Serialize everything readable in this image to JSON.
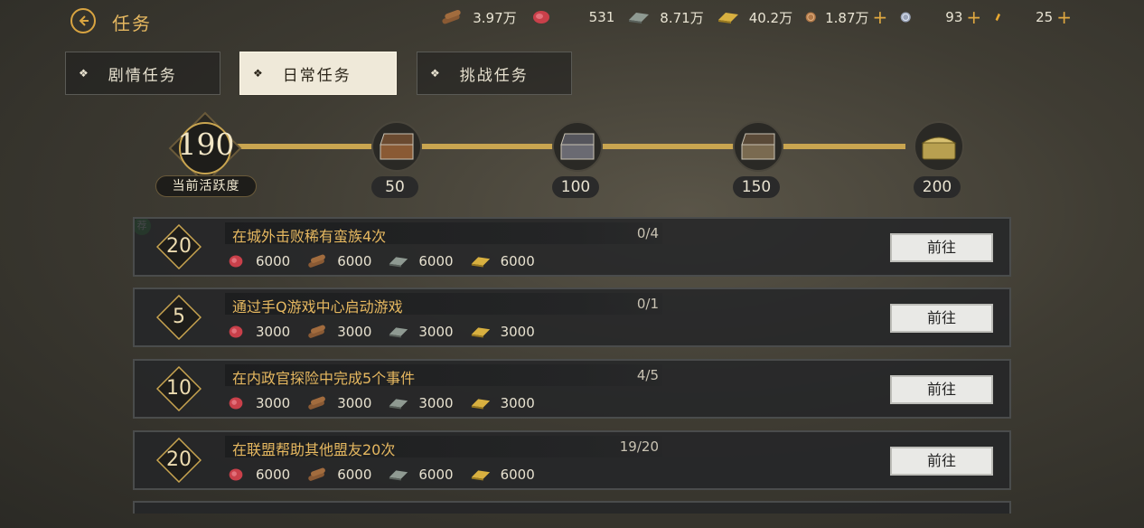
{
  "header": {
    "title": "任务",
    "resources": [
      {
        "icon": "wood-icon",
        "value": "3.97万",
        "plus": false
      },
      {
        "icon": "meat-icon",
        "value": "531",
        "plus": false
      },
      {
        "icon": "iron-icon",
        "value": "8.71万",
        "plus": false
      },
      {
        "icon": "gold-icon",
        "value": "40.2万",
        "plus": false
      },
      {
        "icon": "copper-coin-icon",
        "value": "1.87万",
        "plus": true
      },
      {
        "icon": "silver-coin-icon",
        "value": "93",
        "plus": true
      },
      {
        "icon": "jade-icon",
        "value": "25",
        "plus": true
      }
    ],
    "plus_symbol": "+"
  },
  "tabs": [
    {
      "label": "剧情任务",
      "active": false
    },
    {
      "label": "日常任务",
      "active": true
    },
    {
      "label": "挑战任务",
      "active": false
    }
  ],
  "tab_marker": "❖",
  "activity": {
    "current": "190",
    "current_label": "当前活跃度",
    "milestones": [
      {
        "value": "50",
        "claimed": true
      },
      {
        "value": "100",
        "claimed": true
      },
      {
        "value": "150",
        "claimed": true
      },
      {
        "value": "200",
        "claimed": false
      }
    ]
  },
  "recommend_badge": "荐",
  "tasks": [
    {
      "points": "20",
      "name": "在城外击败稀有蛮族4次",
      "progress": "0/4",
      "progress_fraction": 0,
      "rewards": [
        "6000",
        "6000",
        "6000",
        "6000"
      ],
      "button": "前往"
    },
    {
      "points": "5",
      "name": "通过手Q游戏中心启动游戏",
      "progress": "0/1",
      "progress_fraction": 0,
      "rewards": [
        "3000",
        "3000",
        "3000",
        "3000"
      ],
      "button": "前往"
    },
    {
      "points": "10",
      "name": "在内政官探险中完成5个事件",
      "progress": "4/5",
      "progress_fraction": 0.8,
      "rewards": [
        "3000",
        "3000",
        "3000",
        "3000"
      ],
      "button": "前往"
    },
    {
      "points": "20",
      "name": "在联盟帮助其他盟友20次",
      "progress": "19/20",
      "progress_fraction": 0.95,
      "rewards": [
        "6000",
        "6000",
        "6000",
        "6000"
      ],
      "button": "前往"
    }
  ],
  "reward_icons": [
    "meat-icon",
    "wood-icon",
    "iron-icon",
    "gold-icon"
  ],
  "colors": {
    "accent": "#e6b860",
    "track": "#c9a550",
    "badge": "#2e9a3c"
  }
}
